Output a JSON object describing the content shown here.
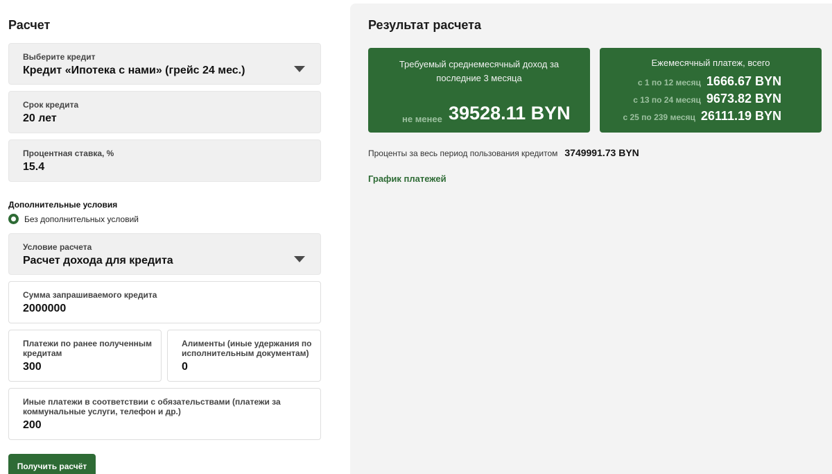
{
  "left": {
    "title": "Расчет",
    "credit_select": {
      "label": "Выберите кредит",
      "value": "Кредит «Ипотека с нами» (грейс 24 мес.)"
    },
    "term": {
      "label": "Срок кредита",
      "value": "20 лет"
    },
    "rate": {
      "label": "Процентная ставка, %",
      "value": "15.4"
    },
    "additional_title": "Дополнительные условия",
    "additional_option": "Без дополнительных условий",
    "condition_select": {
      "label": "Условие расчета",
      "value": "Расчет дохода для кредита"
    },
    "amount": {
      "label": "Сумма запрашиваемого кредита",
      "value": "2000000"
    },
    "prev_loans": {
      "label_line1": "Платежи по ранее полученным",
      "label_line2": "кредитам",
      "value": "300"
    },
    "alimony": {
      "label_line1": "Алименты (иные удержания по",
      "label_line2": "исполнительным документам)",
      "value": "0"
    },
    "other_payments": {
      "label_line1": "Иные платежи в соответствии с обязательствами (платежи за",
      "label_line2": "коммунальные услуги, телефон и др.)",
      "value": "200"
    },
    "submit_label": "Получить расчёт"
  },
  "result": {
    "title": "Результат расчета",
    "income_card": {
      "title_line1": "Требуемый среднемесячный доход за",
      "title_line2": "последние 3 месяца",
      "min_label": "не менее",
      "value": "39528.11 BYN"
    },
    "payment_card": {
      "title": "Ежемесячный платеж, всего",
      "rows": [
        {
          "label": "с 1 по 12 месяц",
          "value": "1666.67 BYN"
        },
        {
          "label": "с 13 по 24 месяц",
          "value": "9673.82 BYN"
        },
        {
          "label": "с 25 по 239 месяц",
          "value": "26111.19 BYN"
        }
      ]
    },
    "interest_label": "Проценты за весь период пользования кредитом",
    "interest_value": "3749991.73 BYN",
    "schedule_link": "График платежей"
  },
  "colors": {
    "accent": "#2e6b35",
    "panel": "#f3f3f3",
    "field": "#f0f0f0"
  }
}
